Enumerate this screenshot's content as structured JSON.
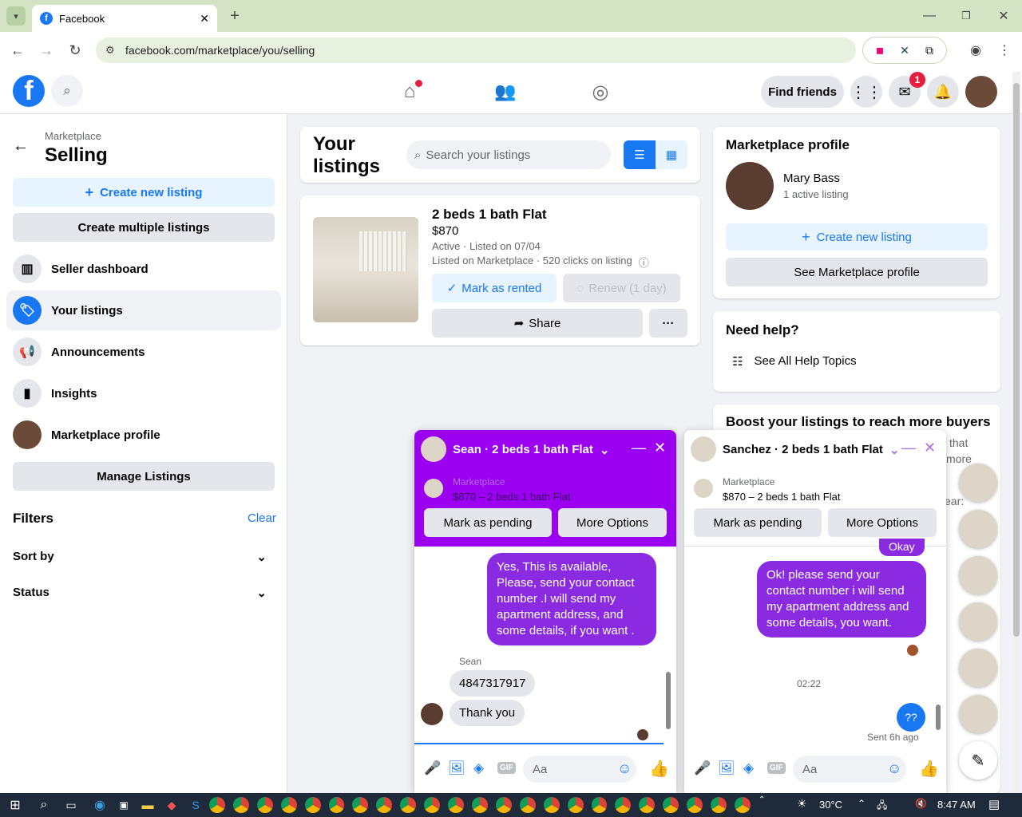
{
  "browser": {
    "tab_title": "Facebook",
    "url": "facebook.com/marketplace/you/selling"
  },
  "header": {
    "find_friends": "Find friends",
    "messenger_badge": "1"
  },
  "sidebar": {
    "breadcrumb": "Marketplace",
    "title": "Selling",
    "create_new_listing": "Create new listing",
    "create_multiple": "Create multiple listings",
    "items": [
      {
        "label": "Seller dashboard"
      },
      {
        "label": "Your listings"
      },
      {
        "label": "Announcements"
      },
      {
        "label": "Insights"
      },
      {
        "label": "Marketplace profile"
      }
    ],
    "manage_listings": "Manage Listings",
    "filters_title": "Filters",
    "clear": "Clear",
    "sort_by": "Sort by",
    "status": "Status"
  },
  "main": {
    "title_line1": "Your",
    "title_line2": "listings",
    "search_placeholder": "Search your listings",
    "listing": {
      "title": "2 beds 1 bath Flat",
      "price": "$870",
      "status": "Active · Listed on 07/04",
      "clicks": "Listed on Marketplace · 520 clicks on listing",
      "mark_rented": "Mark as rented",
      "renew": "Renew (1 day)",
      "share": "Share",
      "more": "···"
    }
  },
  "right": {
    "profile_title": "Marketplace profile",
    "name": "Mary Bass",
    "active": "1 active listing",
    "create_new_listing": "Create new listing",
    "see_profile": "See Marketplace profile",
    "help_title": "Need help?",
    "help_link": "See All Help Topics",
    "boost_title": "Boost your listings to reach more buyers",
    "boost_frag1": "that",
    "boost_frag2": "more",
    "boost_frag3": "ear:"
  },
  "chat1": {
    "title": "Sean · 2 beds 1 bath Flat",
    "sub1": "Marketplace",
    "sub2": "$870 – 2 beds 1 bath Flat",
    "pending": "Mark as pending",
    "more": "More Options",
    "msg_out": "Yes, This is  available, Please, send your contact number .I will send my apartment address, and some details, if you want .",
    "sender": "Sean",
    "msg_in1": "4847317917",
    "msg_in2": "Thank you",
    "input_placeholder": "Aa"
  },
  "chat2": {
    "title": "Sanchez · 2 beds 1 bath Flat",
    "sub1": "Marketplace",
    "sub2": "$870 – 2 beds 1 bath Flat",
    "pending": "Mark as pending",
    "more": "More Options",
    "okay": "Okay",
    "msg_out": "Ok! please send your contact number i will send my apartment address and some details, you want.",
    "time": "02:22",
    "msg_q": "??",
    "sent": "Sent 6h ago",
    "input_placeholder": "Aa"
  },
  "taskbar": {
    "temp": "30°C",
    "time": "8:47 AM"
  }
}
